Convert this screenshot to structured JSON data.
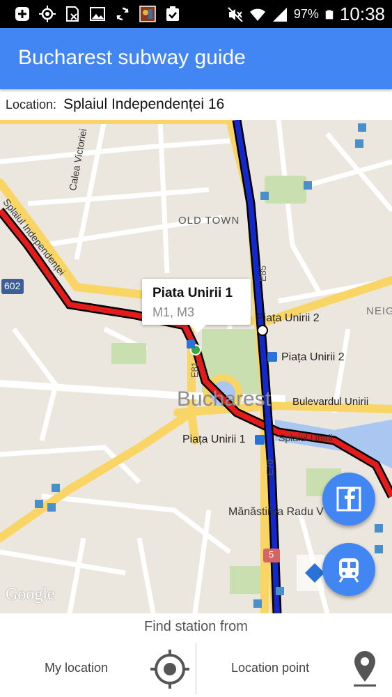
{
  "status_bar": {
    "battery": "97%",
    "time": "10:38"
  },
  "app": {
    "title": "Bucharest subway guide"
  },
  "location_bar": {
    "label": "Location:",
    "value": "Splaiul Independenței 16"
  },
  "map": {
    "labels": {
      "old_town": "OLD TOWN",
      "calea_victoriei": "Calea Victoriei",
      "splaiul_independentei": "Splaiul Independenței",
      "road_602": "602",
      "road_e85": "E85",
      "road_e81": "E81",
      "road_e70": "E70",
      "piata_unirii_2_a": "Piața Unirii 2",
      "piata_unirii_2_b": "Piața Unirii 2",
      "neig": "NEIG",
      "bucharest": "Bucharest",
      "bulevardul_unirii": "Bulevardul Unirii",
      "piata_unirii_1": "Piața Unirii 1",
      "splaiul_unirii": "Splaiul Unirii",
      "manastirea": "Mănăstirea Radu V",
      "road_5": "5",
      "google": "Google"
    },
    "callout": {
      "title": "Piata Unirii 1",
      "lines": "M1, M3"
    },
    "colors": {
      "line_red": "#e21b1b",
      "line_blue": "#1428c8",
      "road_yellow": "#f8d565",
      "water": "#a9c7f0",
      "park": "#c9dfb0",
      "fab_blue": "#4286f4"
    }
  },
  "fab": {
    "facebook_icon": "facebook-icon",
    "subway_icon": "subway-icon"
  },
  "footer": {
    "find_station_from": "Find station from",
    "my_location": "My location",
    "location_point": "Location point"
  }
}
